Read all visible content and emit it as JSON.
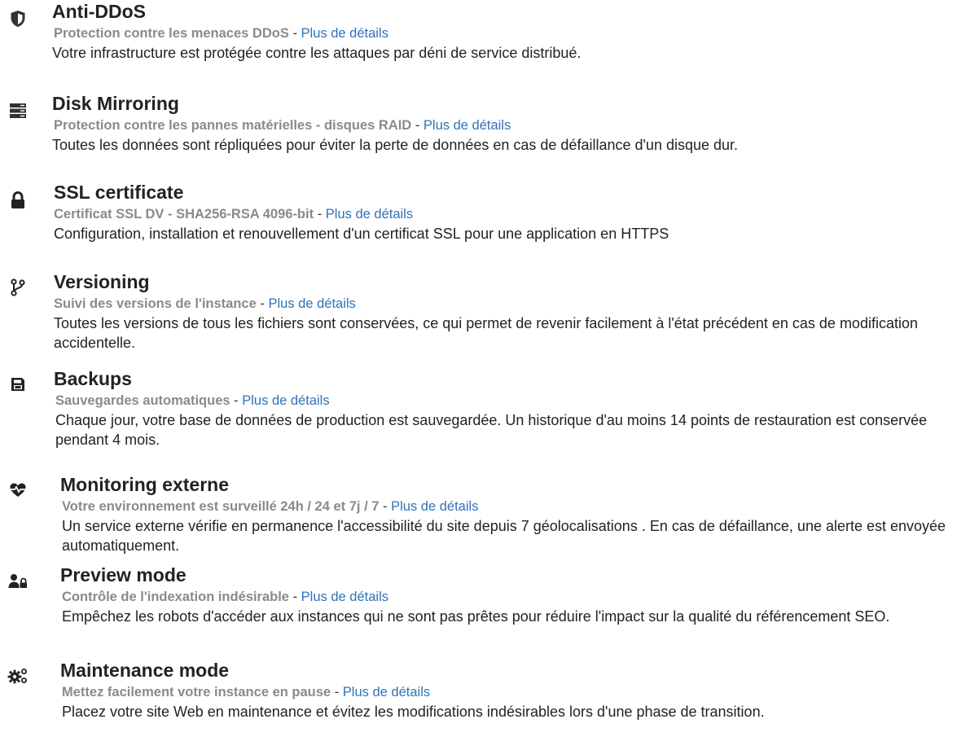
{
  "features": [
    {
      "icon": "shield-icon",
      "title": "Anti-DDoS",
      "subtitle": "Protection contre les menaces DDoS",
      "separator": "-",
      "link": "Plus de détails",
      "description": "Votre infrastructure est protégée contre les attaques par déni de service distribué."
    },
    {
      "icon": "server-icon",
      "title": "Disk Mirroring",
      "subtitle": "Protection contre les pannes matérielles - disques RAID",
      "separator": "-",
      "link": "Plus de détails",
      "description": "Toutes les données sont répliquées pour éviter la perte de données en cas de défaillance d'un disque dur."
    },
    {
      "icon": "lock-icon",
      "title": "SSL certificate",
      "subtitle": "Certificat SSL DV - SHA256-RSA 4096-bit",
      "separator": "-",
      "link": "Plus de détails",
      "description": "Configuration, installation et renouvellement d'un certificat SSL pour une application en HTTPS"
    },
    {
      "icon": "code-branch-icon",
      "title": "Versioning",
      "subtitle": "Suivi des versions de l'instance",
      "separator": "-",
      "link": "Plus de détails",
      "description": "Toutes les versions de tous les fichiers sont conservées, ce qui permet de revenir facilement à l'état précédent en cas de modification accidentelle."
    },
    {
      "icon": "floppy-disk-icon",
      "title": "Backups",
      "subtitle": "Sauvegardes automatiques",
      "separator": "-",
      "link": "Plus de détails",
      "description": "Chaque jour, votre base de données de production est sauvegardée. Un historique d'au moins 14 points de restauration est conservée pendant 4 mois."
    },
    {
      "icon": "heartbeat-icon",
      "title": "Monitoring externe",
      "subtitle": "Votre environnement est surveillé 24h / 24 et 7j / 7",
      "separator": "-",
      "link": "Plus de détails",
      "description": "Un service externe vérifie en permanence l'accessibilité du site depuis 7 géolocalisations . En cas de défaillance, une alerte est envoyée automatiquement."
    },
    {
      "icon": "user-lock-icon",
      "title": "Preview mode",
      "subtitle": "Contrôle de l'indexation indésirable",
      "separator": "-",
      "link": "Plus de détails",
      "description": "Empêchez les robots d'accéder aux instances qui ne sont pas prêtes pour réduire l'impact sur la qualité du référencement SEO."
    },
    {
      "icon": "cogs-icon",
      "title": "Maintenance mode",
      "subtitle": "Mettez facilement votre instance en pause",
      "separator": "-",
      "link": "Plus de détails",
      "description": "Placez votre site Web en maintenance et évitez les modifications indésirables lors d'une phase de transition."
    }
  ]
}
